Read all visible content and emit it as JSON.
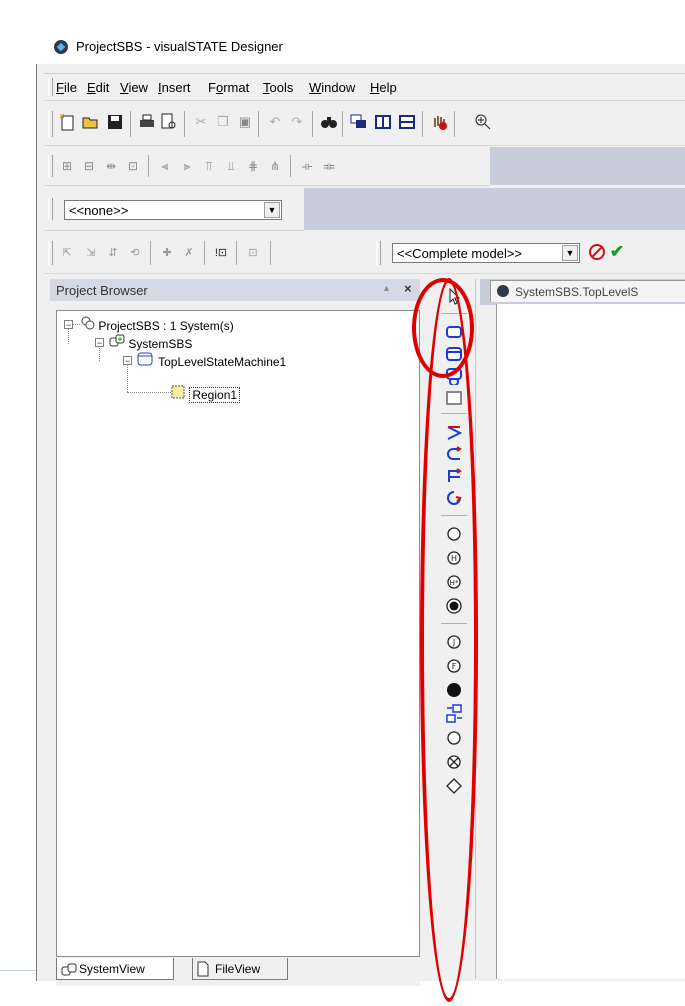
{
  "window": {
    "title": "ProjectSBS - visualSTATE Designer"
  },
  "menubar": {
    "items": [
      "File",
      "Edit",
      "View",
      "Insert",
      "Format",
      "Tools",
      "Window",
      "Help"
    ]
  },
  "toolbar": {
    "state_combo": {
      "value": "<<none>>"
    },
    "model_combo": {
      "value": "<<Complete model>>"
    }
  },
  "project_browser": {
    "title": "Project Browser",
    "pin": "▴",
    "close": "×",
    "tree": [
      {
        "label": "ProjectSBS : 1 System(s)",
        "icon": "project-icon",
        "expanded": true
      },
      {
        "label": "SystemSBS",
        "icon": "system-icon",
        "expanded": true
      },
      {
        "label": "TopLevelStateMachine1",
        "icon": "statemachine-icon",
        "expanded": true
      },
      {
        "label": "Region1",
        "icon": "region-icon",
        "selected": true
      }
    ],
    "tabs": [
      {
        "label": "SystemView",
        "icon": "system-icon"
      },
      {
        "label": "FileView",
        "icon": "file-icon"
      }
    ]
  },
  "palette": {
    "tools": [
      "pointer-tool",
      "state-tool",
      "state-with-header-tool",
      "state-loop-tool",
      "region-tool",
      "transition-tool",
      "transition-back-tool",
      "transition-square-tool",
      "self-transition-tool",
      "junction-tool",
      "history-tool",
      "deep-history-tool",
      "initial-state-tool",
      "join-tool",
      "final-tool",
      "final-state-tool",
      "connector-tool",
      "entry-point-tool",
      "exit-point-tool",
      "choice-tool"
    ]
  },
  "document": {
    "tab_title": "SystemSBS.TopLevelS"
  },
  "colors": {
    "annotation": "#e00000",
    "ide_band": "#c8ccdb",
    "panel_header": "#d6d9e4"
  }
}
